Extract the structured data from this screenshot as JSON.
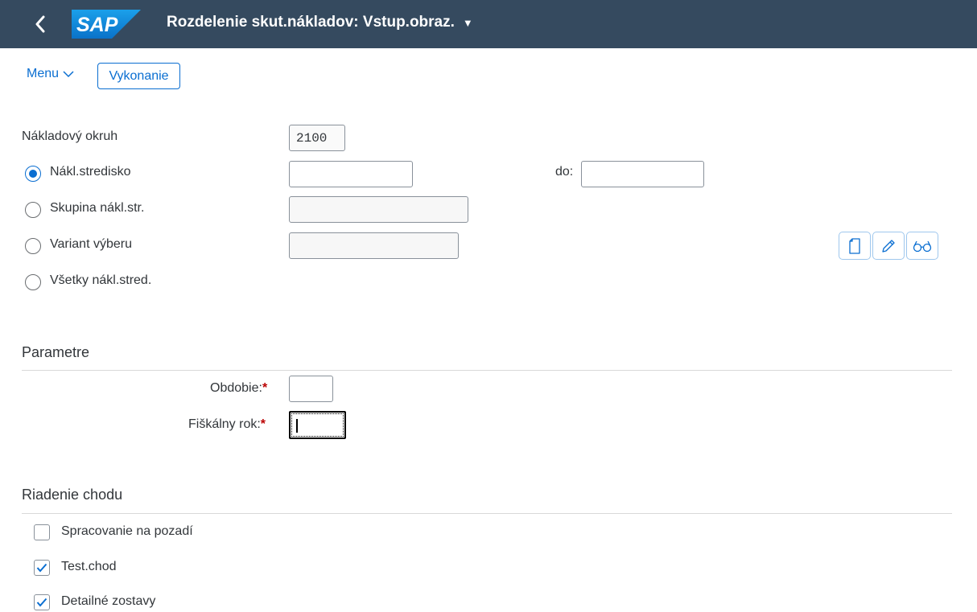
{
  "header": {
    "logo_text": "SAP",
    "title": "Rozdelenie skut.nákladov: Vstup.obraz.",
    "bg_color": "#354a5f"
  },
  "toolbar": {
    "menu_label": "Menu",
    "execute_label": "Vykonanie"
  },
  "selection": {
    "controlling_area_label": "Nákladový okruh",
    "controlling_area_value": "2100",
    "options": [
      {
        "label": "Nákl.stredisko",
        "selected": true
      },
      {
        "label": "Skupina nákl.str.",
        "selected": false
      },
      {
        "label": "Variant výberu",
        "selected": false
      },
      {
        "label": "Všetky nákl.stred.",
        "selected": false
      }
    ],
    "to_label": "do:",
    "variant_icons": [
      "create-icon",
      "edit-icon",
      "display-icon"
    ]
  },
  "parameters": {
    "section_title": "Parametre",
    "period_label": "Obdobie:",
    "fiscal_year_label": "Fiškálny rok:",
    "required_marker": "*"
  },
  "processing": {
    "section_title": "Riadenie chodu",
    "options": [
      {
        "label": "Spracovanie na pozadí",
        "checked": false
      },
      {
        "label": "Test.chod",
        "checked": true
      },
      {
        "label": "Detailné zostavy",
        "checked": true
      }
    ]
  },
  "colors": {
    "accent": "#0a6ed1",
    "required": "#bb0000"
  }
}
